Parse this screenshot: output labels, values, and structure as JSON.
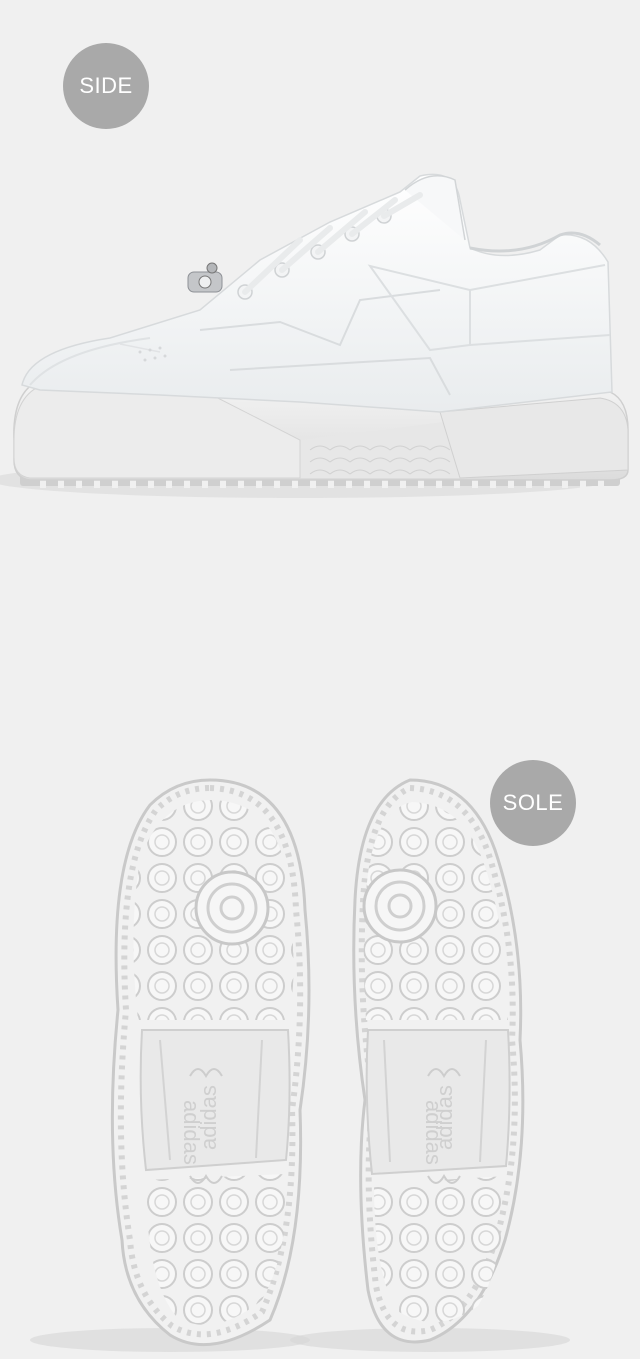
{
  "panels": {
    "side": {
      "label": "SIDE"
    },
    "sole": {
      "label": "SOLE",
      "brand_text": "adidas"
    }
  },
  "colors": {
    "background": "#f0f0f0",
    "badge": "#a9a9a9",
    "badge_text": "#ffffff",
    "shoe_white": "#fbfbfb",
    "shoe_shadow": "#d6d8da"
  },
  "icons": [
    "sneaker-side-view",
    "sneaker-sole-view",
    "adidas-trefoil-icon",
    "jewel-charm-icon"
  ]
}
